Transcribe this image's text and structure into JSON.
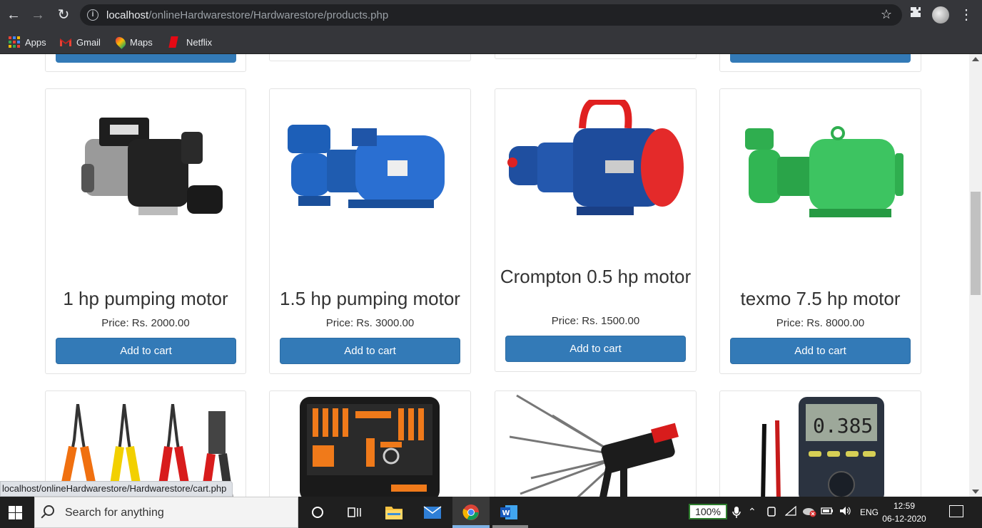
{
  "browser": {
    "url_host": "localhost",
    "url_path": "/onlineHardwarestore/Hardwarestore/products.php",
    "bookmarks": [
      {
        "label": "Apps",
        "icon": "apps-grid-icon"
      },
      {
        "label": "Gmail",
        "icon": "gmail-icon"
      },
      {
        "label": "Maps",
        "icon": "maps-icon"
      },
      {
        "label": "Netflix",
        "icon": "netflix-icon"
      }
    ]
  },
  "products": [
    {
      "title": "1 hp pumping motor",
      "price": "Price: Rs. 2000.00",
      "button": "Add to cart",
      "image": "pump-motor-black"
    },
    {
      "title": "1.5 hp pumping motor",
      "price": "Price: Rs. 3000.00",
      "button": "Add to cart",
      "image": "pump-motor-blue"
    },
    {
      "title": "Crompton 0.5 hp motor",
      "price": "Price: Rs. 1500.00",
      "button": "Add to cart",
      "image": "pump-motor-blue-red"
    },
    {
      "title": "texmo 7.5 hp motor",
      "price": "Price: Rs. 8000.00",
      "button": "Add to cart",
      "image": "pump-motor-green"
    }
  ],
  "status_bar_url": "localhost/onlineHardwarestore/Hardwarestore/cart.php",
  "taskbar": {
    "search_placeholder": "Search for anything",
    "zoom": "100%",
    "language": "ENG",
    "time": "12:59",
    "date": "06-12-2020"
  },
  "colors": {
    "button_blue": "#337ab7",
    "chrome_dark": "#35363a"
  }
}
